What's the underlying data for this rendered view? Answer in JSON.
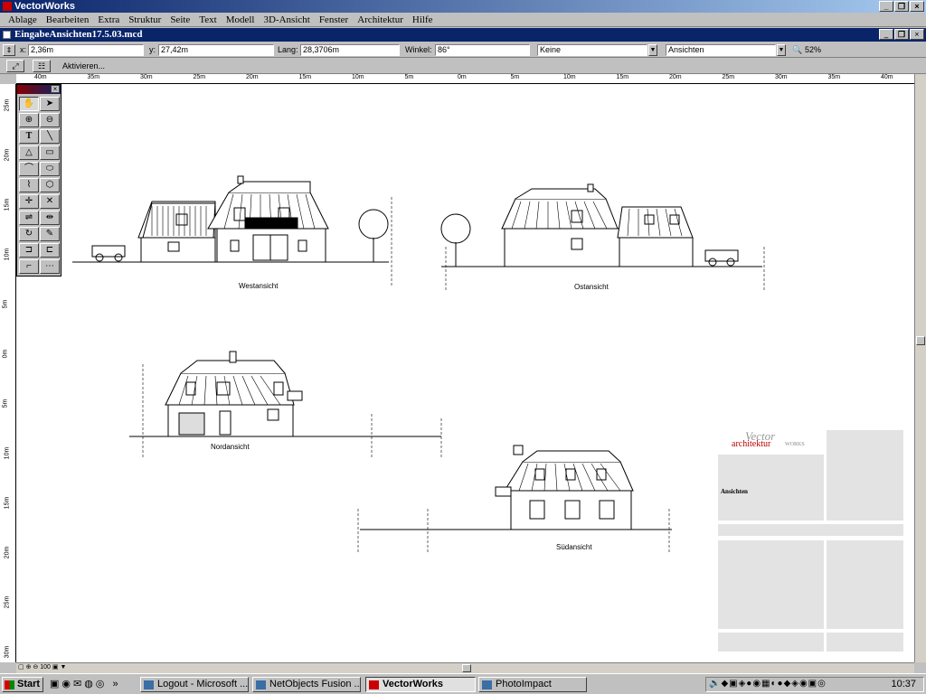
{
  "app": {
    "title": "VectorWorks"
  },
  "menu": [
    "Ablage",
    "Bearbeiten",
    "Extra",
    "Struktur",
    "Seite",
    "Text",
    "Modell",
    "3D-Ansicht",
    "Fenster",
    "Architektur",
    "Hilfe"
  ],
  "document": {
    "title": "EingabeAnsichten17.5.03.mcd"
  },
  "coords": {
    "x_label": "x:",
    "x_value": "2,36m",
    "y_label": "y:",
    "y_value": "27,42m",
    "len_label": "Lang:",
    "len_value": "28,3706m",
    "angle_label": "Winkel:",
    "angle_value": "86°",
    "class_value": "Keine",
    "layer_value": "Ansichten",
    "zoom_value": "52%"
  },
  "mode": {
    "activate_label": "Aktivieren..."
  },
  "ruler_top": [
    "40m",
    "35m",
    "30m",
    "25m",
    "20m",
    "15m",
    "10m",
    "5m",
    "0m",
    "5m",
    "10m",
    "15m",
    "20m",
    "25m",
    "30m",
    "35m",
    "40m"
  ],
  "ruler_left": [
    "25m",
    "20m",
    "15m",
    "10m",
    "5m",
    "0m",
    "5m",
    "10m",
    "15m",
    "20m",
    "25m",
    "30m"
  ],
  "views": {
    "west": "Westansicht",
    "ost": "Ostansicht",
    "nord": "Nordansicht",
    "sued": "Südansicht"
  },
  "titleblock": {
    "logo_top": "Vector",
    "logo_main": "architektur",
    "logo_sub": "WORKS",
    "drawing_name": "Ansichten"
  },
  "bottom_zoom": "100",
  "taskbar": {
    "start": "Start",
    "tasks": [
      {
        "label": "Logout - Microsoft ..."
      },
      {
        "label": "NetObjects Fusion ..."
      },
      {
        "label": "VectorWorks"
      },
      {
        "label": "PhotoImpact"
      }
    ],
    "clock": "10:37"
  }
}
